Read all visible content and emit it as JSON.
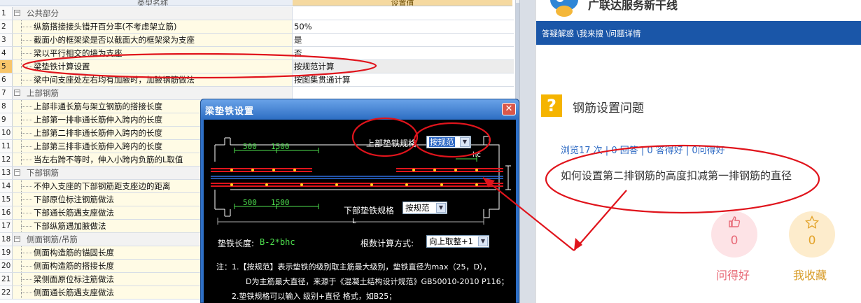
{
  "table": {
    "col_name_header": "类型名称",
    "col_value_header": "设置值",
    "rows": [
      {
        "num": "1",
        "name": "公共部分",
        "value": "",
        "group": true
      },
      {
        "num": "2",
        "name": "纵筋搭接接头错开百分率(不考虑架立筋)",
        "value": "50%"
      },
      {
        "num": "3",
        "name": "截面小的框架梁是否以截面大的框架梁为支座",
        "value": "是"
      },
      {
        "num": "4",
        "name": "梁以平行相交的墙为支座",
        "value": "否"
      },
      {
        "num": "5",
        "name": "梁垫铁计算设置",
        "value": "按规范计算",
        "selected": true
      },
      {
        "num": "6",
        "name": "梁中间支座处左右均有加腋时，加腋钢筋做法",
        "value": "按图集贯通计算"
      },
      {
        "num": "7",
        "name": "上部钢筋",
        "value": "",
        "group": true
      },
      {
        "num": "8",
        "name": "上部非通长筋与架立钢筋的搭接长度",
        "value": ""
      },
      {
        "num": "9",
        "name": "上部第一排非通长筋伸入跨内的长度",
        "value": ""
      },
      {
        "num": "10",
        "name": "上部第二排非通长筋伸入跨内的长度",
        "value": ""
      },
      {
        "num": "11",
        "name": "上部第三排非通长筋伸入跨内的长度",
        "value": ""
      },
      {
        "num": "12",
        "name": "当左右跨不等时，伸入小跨内负筋的L取值",
        "value": ""
      },
      {
        "num": "13",
        "name": "下部钢筋",
        "value": "",
        "group": true
      },
      {
        "num": "14",
        "name": "不伸入支座的下部钢筋距支座边的距离",
        "value": ""
      },
      {
        "num": "15",
        "name": "下部原位标注钢筋做法",
        "value": ""
      },
      {
        "num": "16",
        "name": "下部通长筋遇支座做法",
        "value": ""
      },
      {
        "num": "17",
        "name": "下部纵筋遇加腋做法",
        "value": ""
      },
      {
        "num": "18",
        "name": "侧面钢筋/吊筋",
        "value": "",
        "group": true
      },
      {
        "num": "19",
        "name": "侧面构造筋的锚固长度",
        "value": ""
      },
      {
        "num": "20",
        "name": "侧面构造筋的搭接长度",
        "value": ""
      },
      {
        "num": "21",
        "name": "梁侧面原位标注筋做法",
        "value": ""
      },
      {
        "num": "22",
        "name": "侧面通长筋遇支座做法",
        "value": ""
      }
    ]
  },
  "dialog": {
    "title": "梁垫铁设置",
    "close_icon": "close-icon",
    "top_label": "上部垫铁规格",
    "top_value": "按规范",
    "bottom_label": "下部垫铁规格",
    "bottom_value": "按规范",
    "dim_500_top": "500",
    "dim_1500_top": "1500",
    "dim_500_bottom": "500",
    "dim_1500_bottom": "1500",
    "dim_hc": "hc",
    "dim_l": "L",
    "length_label": "垫铁长度:",
    "length_value": "B-2*bhc",
    "count_label": "根数计算方式:",
    "count_value": "向上取整+1",
    "note1": "注：1.【按规范】表示垫铁的级别取主筋最大级别，垫铁直径为max（25，D），",
    "note2": "D为主筋最大直径，来源于《混凝土结构设计规范》GB50010-2010 P116；",
    "note3": "2.垫铁规格可以输入 级别+直径 格式，如B25；"
  },
  "qa": {
    "brand": "广联达服务新干线",
    "breadcrumb": "答疑解惑 \\我来搜 \\问题详情",
    "question_title": "钢筋设置问题",
    "stats": "浏览17 次 | 0 回答 | 0 答得好 | 0问得好",
    "question_body": "如何设置第二排钢筋的高度扣减第一排钢筋的直径",
    "like_count": "0",
    "fav_count": "0",
    "like_label": "问得好",
    "fav_label": "我收藏",
    "like_icon": "thumbs-up-icon",
    "fav_icon": "star-icon"
  },
  "colors": {
    "annotation_red": "#e0141c",
    "nav_blue": "#1a56a8",
    "selected_row": "#f7c56a"
  }
}
